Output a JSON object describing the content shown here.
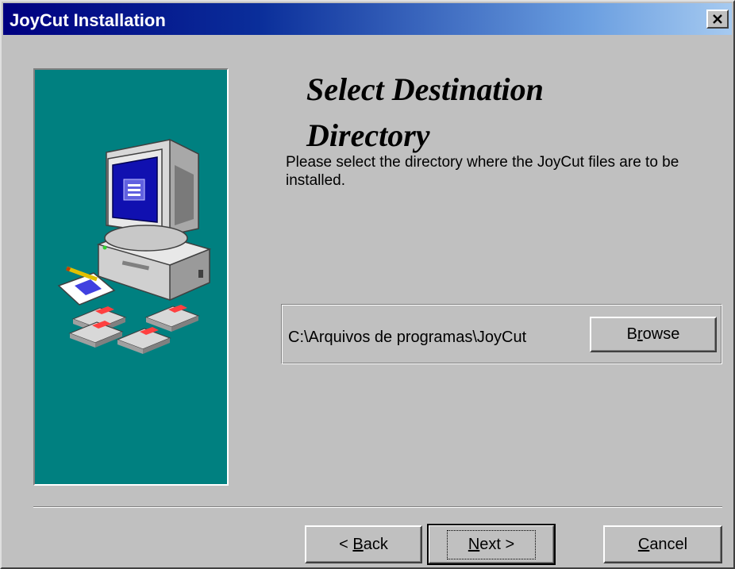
{
  "window": {
    "title": "JoyCut Installation",
    "close_symbol": "×"
  },
  "icons": {
    "side_illustration": "computer-with-disks-illustration",
    "close": "close-icon"
  },
  "heading": {
    "line1": "Select Destination",
    "line2": "Directory"
  },
  "description": "Please select the directory where the JoyCut files are to be installed.",
  "destination": {
    "path": "C:\\Arquivos de programas\\JoyCut",
    "browse": {
      "pre": "B",
      "accel": "r",
      "post": "owse"
    }
  },
  "buttons": {
    "back": {
      "pre": "< ",
      "accel": "B",
      "post": "ack"
    },
    "next": {
      "pre": "",
      "accel": "N",
      "post": "ext >"
    },
    "cancel": {
      "pre": "",
      "accel": "C",
      "post": "ancel"
    }
  },
  "colors": {
    "title_bar_start": "#000080",
    "title_bar_end": "#a6caf0",
    "panel_teal": "#008080",
    "face": "#c0c0c0"
  }
}
